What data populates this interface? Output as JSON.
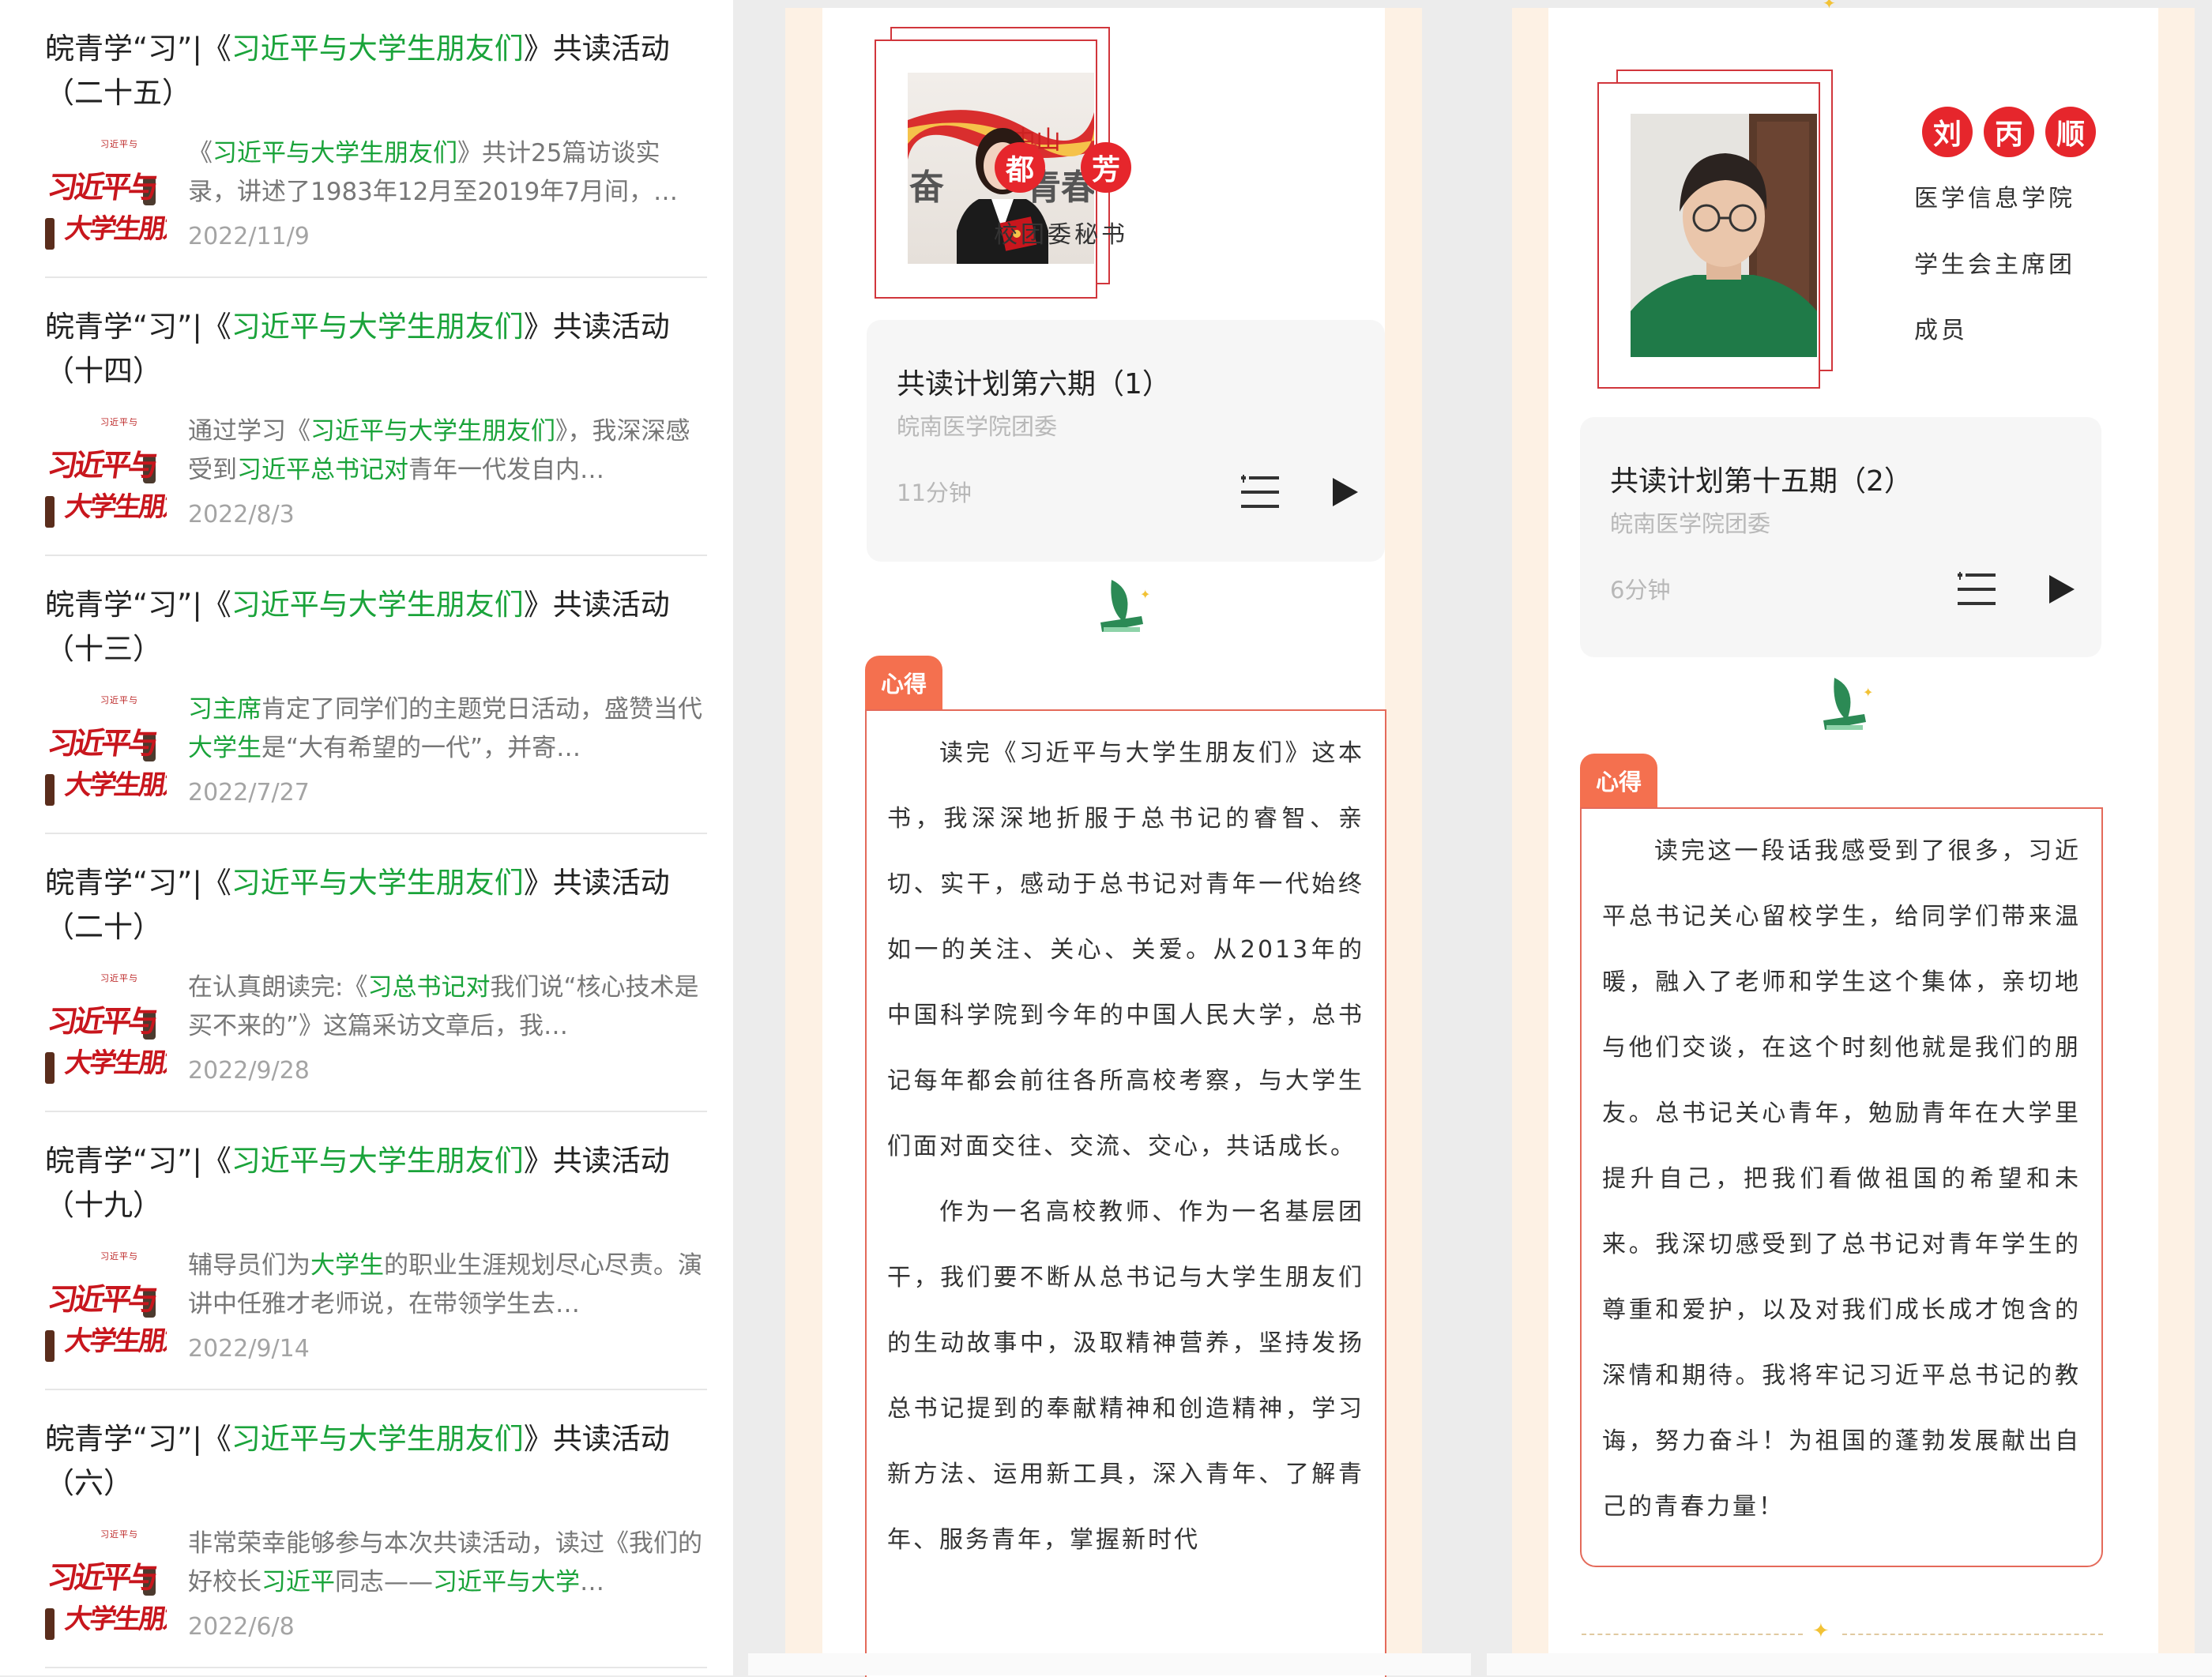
{
  "articles": [
    {
      "title_prefix": "皖青学“习”|《",
      "title_hl": "习近平与大学生朋友们",
      "title_suffix": "》共读活动（二十五）",
      "summary_parts": [
        {
          "t": "《",
          "h": false
        },
        {
          "t": "习近平与大学生朋友们",
          "h": true
        },
        {
          "t": "》共计25篇访谈实录，讲述了1983年12月至2019年7月间，…",
          "h": false
        }
      ],
      "date": "2022/11/9"
    },
    {
      "title_prefix": "皖青学“习”|《",
      "title_hl": "习近平与大学生朋友们",
      "title_suffix": "》共读活动（十四）",
      "summary_parts": [
        {
          "t": "通过学习《",
          "h": false
        },
        {
          "t": "习近平与大学生朋友们",
          "h": true
        },
        {
          "t": "》，我深深感受到",
          "h": false
        },
        {
          "t": "习近平总书记对",
          "h": true
        },
        {
          "t": "青年一代发自内…",
          "h": false
        }
      ],
      "date": "2022/8/3"
    },
    {
      "title_prefix": "皖青学“习”|《",
      "title_hl": "习近平与大学生朋友们",
      "title_suffix": "》共读活动（十三）",
      "summary_parts": [
        {
          "t": "习主席",
          "h": true
        },
        {
          "t": "肯定了同学们的主题党日活动，盛赞当代",
          "h": false
        },
        {
          "t": "大学生",
          "h": true
        },
        {
          "t": "是“大有希望的一代”，并寄…",
          "h": false
        }
      ],
      "date": "2022/7/27"
    },
    {
      "title_prefix": "皖青学“习”|《",
      "title_hl": "习近平与大学生朋友们",
      "title_suffix": "》共读活动（二十）",
      "summary_parts": [
        {
          "t": "在认真朗读完:《",
          "h": false
        },
        {
          "t": "习总书记对",
          "h": true
        },
        {
          "t": "我们说“核心技术是买不来的”》这篇采访文章后，我…",
          "h": false
        }
      ],
      "date": "2022/9/28"
    },
    {
      "title_prefix": "皖青学“习”|《",
      "title_hl": "习近平与大学生朋友们",
      "title_suffix": "》共读活动（十九）",
      "summary_parts": [
        {
          "t": "辅导员们为",
          "h": false
        },
        {
          "t": "大学生",
          "h": true
        },
        {
          "t": "的职业生涯规划尽心尽责。演讲中任雅才老师说，在带领学生去…",
          "h": false
        }
      ],
      "date": "2022/9/14"
    },
    {
      "title_prefix": "皖青学“习”|《",
      "title_hl": "习近平与大学生朋友们",
      "title_suffix": "》共读活动（六）",
      "summary_parts": [
        {
          "t": "非常荣幸能够参与本次共读活动，读过《我们的好校长",
          "h": false
        },
        {
          "t": "习近平",
          "h": true
        },
        {
          "t": "同志——",
          "h": false
        },
        {
          "t": "习近平与大学",
          "h": true
        },
        {
          "t": "…",
          "h": false
        }
      ],
      "date": "2022/6/8"
    }
  ],
  "thumb": {
    "small_text": "习近平与",
    "line1": "习近平与",
    "line2": "大学生朋友"
  },
  "middle": {
    "name_chars": [
      "都",
      "芳"
    ],
    "role": "校团委秘书",
    "audio": {
      "title": "共读计划第六期（1）",
      "org": "皖南医学院团委",
      "duration": "11分钟"
    },
    "tag": "心得",
    "paragraphs": [
      "读完《习近平与大学生朋友们》这本书，我深深地折服于总书记的睿智、亲切、实干，感动于总书记对青年一代始终如一的关注、关心、关爱。从2013年的中国科学院到今年的中国人民大学，总书记每年都会前往各所高校考察，与大学生们面对面交往、交流、交心，共话成长。",
      "作为一名高校教师、作为一名基层团干，我们要不断从总书记与大学生朋友们的生动故事中，汲取精神营养，坚持发扬总书记提到的奉献精神和创造精神，学习新方法、运用新工具，深入青年、了解青年、服务青年，掌握新时代"
    ],
    "photo_banner": {
      "a": "奋",
      "b": "中山",
      "c": "青春"
    }
  },
  "right": {
    "name_chars": [
      "刘",
      "丙",
      "顺"
    ],
    "role_lines": [
      "医学信息学院",
      "学生会主席团",
      "成员"
    ],
    "audio": {
      "title": "共读计划第十五期（2）",
      "org": "皖南医学院团委",
      "duration": "6分钟"
    },
    "tag": "心得",
    "paragraphs": [
      "读完这一段话我感受到了很多，习近平总书记关心留校学生，给同学们带来温暖，融入了老师和学生这个集体，亲切地与他们交谈，在这个时刻他就是我们的朋友。总书记关心青年，勉励青年在大学里提升自己，把我们看做祖国的希望和未来。我深切感受到了总书记对青年学生的尊重和爱护，以及对我们成长成才饱含的深情和期待。我将牢记习近平总书记的教诲，努力奋斗！为祖国的蓬勃发展献出自己的青春力量！"
    ]
  },
  "colors": {
    "accent_red": "#e6262c",
    "frame_red": "#d1363c",
    "tag_orange": "#f4704f",
    "link_green": "#1aa33a",
    "strip_cream": "#fdf1e4"
  }
}
